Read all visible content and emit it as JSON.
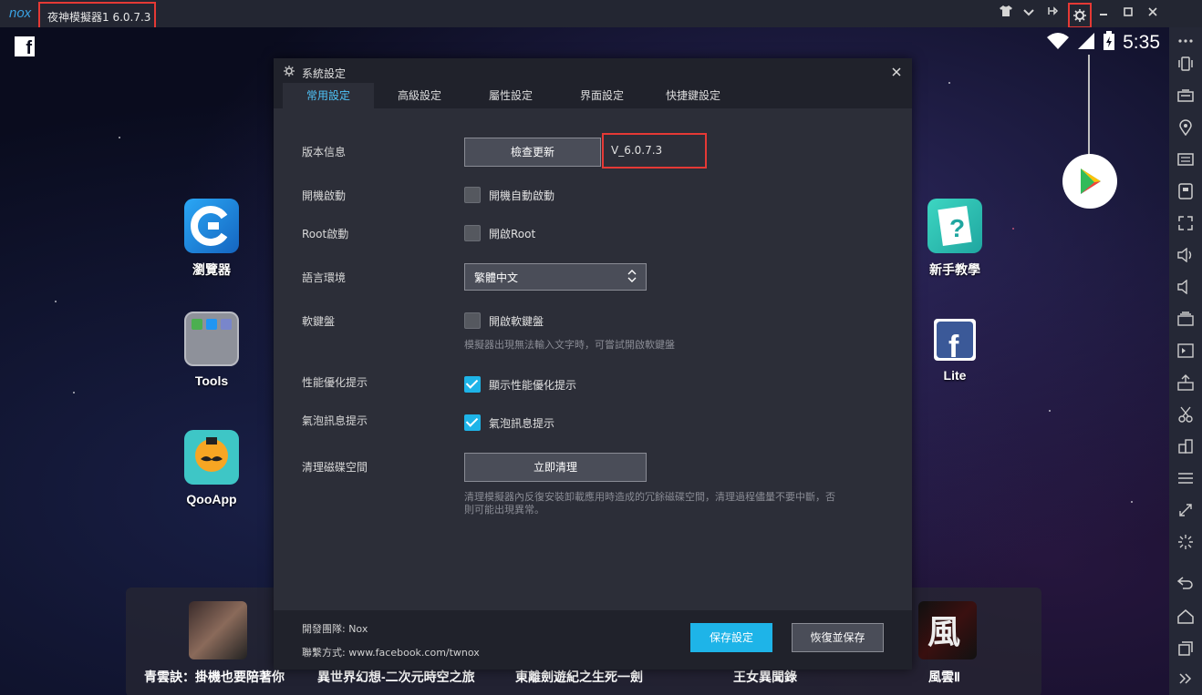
{
  "titlebar": {
    "logo": "nox",
    "title": "夜神模擬器1 6.0.7.3"
  },
  "status_bar": {
    "clock": "5:35"
  },
  "home_apps": {
    "left": [
      {
        "label": "瀏覽器",
        "icon": "browser-icon"
      },
      {
        "label": "Tools",
        "icon": "folder-icon"
      },
      {
        "label": "QooApp",
        "icon": "qooapp-icon"
      }
    ],
    "right": [
      {
        "label": "新手教學",
        "icon": "tutorial-icon"
      },
      {
        "label": "Lite",
        "icon": "facebook-lite-icon"
      }
    ]
  },
  "dock_games": [
    "青雲訣：掛機也要陪著你",
    "異世界幻想-二次元時空之旅",
    "東離劍遊紀之生死一劍",
    "王女異聞錄",
    "風雲Ⅱ"
  ],
  "dialog": {
    "title": "系統設定",
    "tabs": [
      "常用設定",
      "高級設定",
      "屬性設定",
      "界面設定",
      "快捷鍵設定"
    ],
    "active_tab": 0,
    "rows": {
      "version_label": "版本信息",
      "check_update_button": "檢查更新",
      "version_value": "V_6.0.7.3",
      "boot_label": "開機啟動",
      "boot_checkbox_label": "開機自動啟動",
      "boot_checked": false,
      "root_label": "Root啟動",
      "root_checkbox_label": "開啟Root",
      "root_checked": false,
      "language_label": "語言環境",
      "language_value": "繁體中文",
      "softkb_label": "軟鍵盤",
      "softkb_checkbox_label": "開啟軟鍵盤",
      "softkb_checked": false,
      "softkb_hint": "模擬器出現無法輸入文字時，可嘗試開啟軟鍵盤",
      "perf_label": "性能優化提示",
      "perf_checkbox_label": "顯示性能優化提示",
      "perf_checked": true,
      "bubble_label": "氣泡訊息提示",
      "bubble_checkbox_label": "氣泡訊息提示",
      "bubble_checked": true,
      "disk_label": "清理磁碟空間",
      "disk_button": "立即清理",
      "disk_hint_line1": "清理模擬器內反復安裝卸載應用時造成的冗餘磁碟空間，清理過程儘量不要中斷，否",
      "disk_hint_line2": "則可能出現異常。"
    },
    "footer": {
      "team": "開發團隊:   Nox",
      "contact": "聯繫方式:   www.facebook.com/twnox",
      "save_button": "保存設定",
      "reset_button": "恢復並保存"
    }
  },
  "colors": {
    "accent": "#1eb4e8",
    "highlight": "#e53935",
    "dialog_bg": "#2c2e38",
    "titlebar_bg": "#232632"
  }
}
